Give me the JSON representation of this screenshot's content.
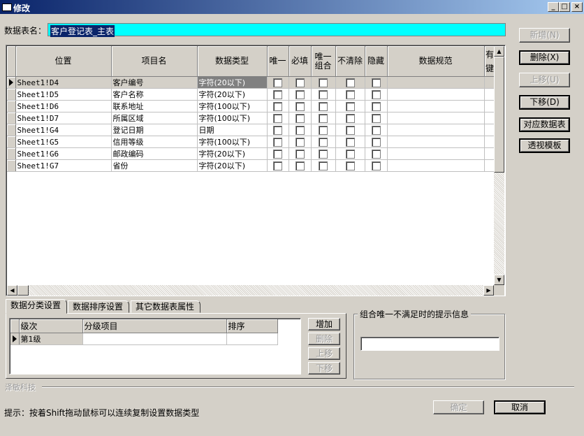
{
  "window": {
    "title": "修改",
    "controls": [
      "_",
      "□",
      "×"
    ]
  },
  "form": {
    "table_name_label": "数据表名：",
    "table_name_value": "客户登记表_主表"
  },
  "grid": {
    "columns": [
      "位置",
      "项目名",
      "数据类型",
      "唯一",
      "必填",
      "唯一组合",
      "不清除",
      "隐藏",
      "数据规范",
      "有键"
    ],
    "column_last_top": "有",
    "column_last_bottom": "键",
    "rows": [
      {
        "position": "Sheet1!D4",
        "name": "客户编号",
        "type": "字符(20以下)"
      },
      {
        "position": "Sheet1!D5",
        "name": "客户名称",
        "type": "字符(20以下)"
      },
      {
        "position": "Sheet1!D6",
        "name": "联系地址",
        "type": "字符(100以下)"
      },
      {
        "position": "Sheet1!D7",
        "name": "所属区域",
        "type": "字符(100以下)"
      },
      {
        "position": "Sheet1!G4",
        "name": "登记日期",
        "type": "日期"
      },
      {
        "position": "Sheet1!G5",
        "name": "信用等级",
        "type": "字符(100以下)"
      },
      {
        "position": "Sheet1!G6",
        "name": "邮政编码",
        "type": "字符(20以下)"
      },
      {
        "position": "Sheet1!G7",
        "name": "省份",
        "type": "字符(20以下)"
      }
    ],
    "header_unique_combo_line1": "唯一",
    "header_unique_combo_line2": "组合"
  },
  "side_buttons": {
    "add": "新增(N)",
    "delete": "删除(X)",
    "move_up": "上移(U)",
    "move_down": "下移(D)",
    "map_table": "对应数据表",
    "pivot_template": "透视模板"
  },
  "tabs": [
    "数据分类设置",
    "数据排序设置",
    "其它数据表属性"
  ],
  "subgrid": {
    "columns": [
      "级次",
      "分级项目",
      "排序"
    ],
    "rows": [
      {
        "level": "第1级",
        "item": "",
        "order": ""
      }
    ]
  },
  "sub_buttons": {
    "add": "增加",
    "delete": "删除",
    "move_up": "上移",
    "move_down": "下移"
  },
  "groupbox": {
    "label": "组合唯一不满足时的提示信息",
    "value": ""
  },
  "footer": {
    "brand": "泽敏科技",
    "hint": "提示：按着Shift拖动鼠标可以连续复制设置数据类型",
    "ok": "确定",
    "cancel": "取消"
  }
}
